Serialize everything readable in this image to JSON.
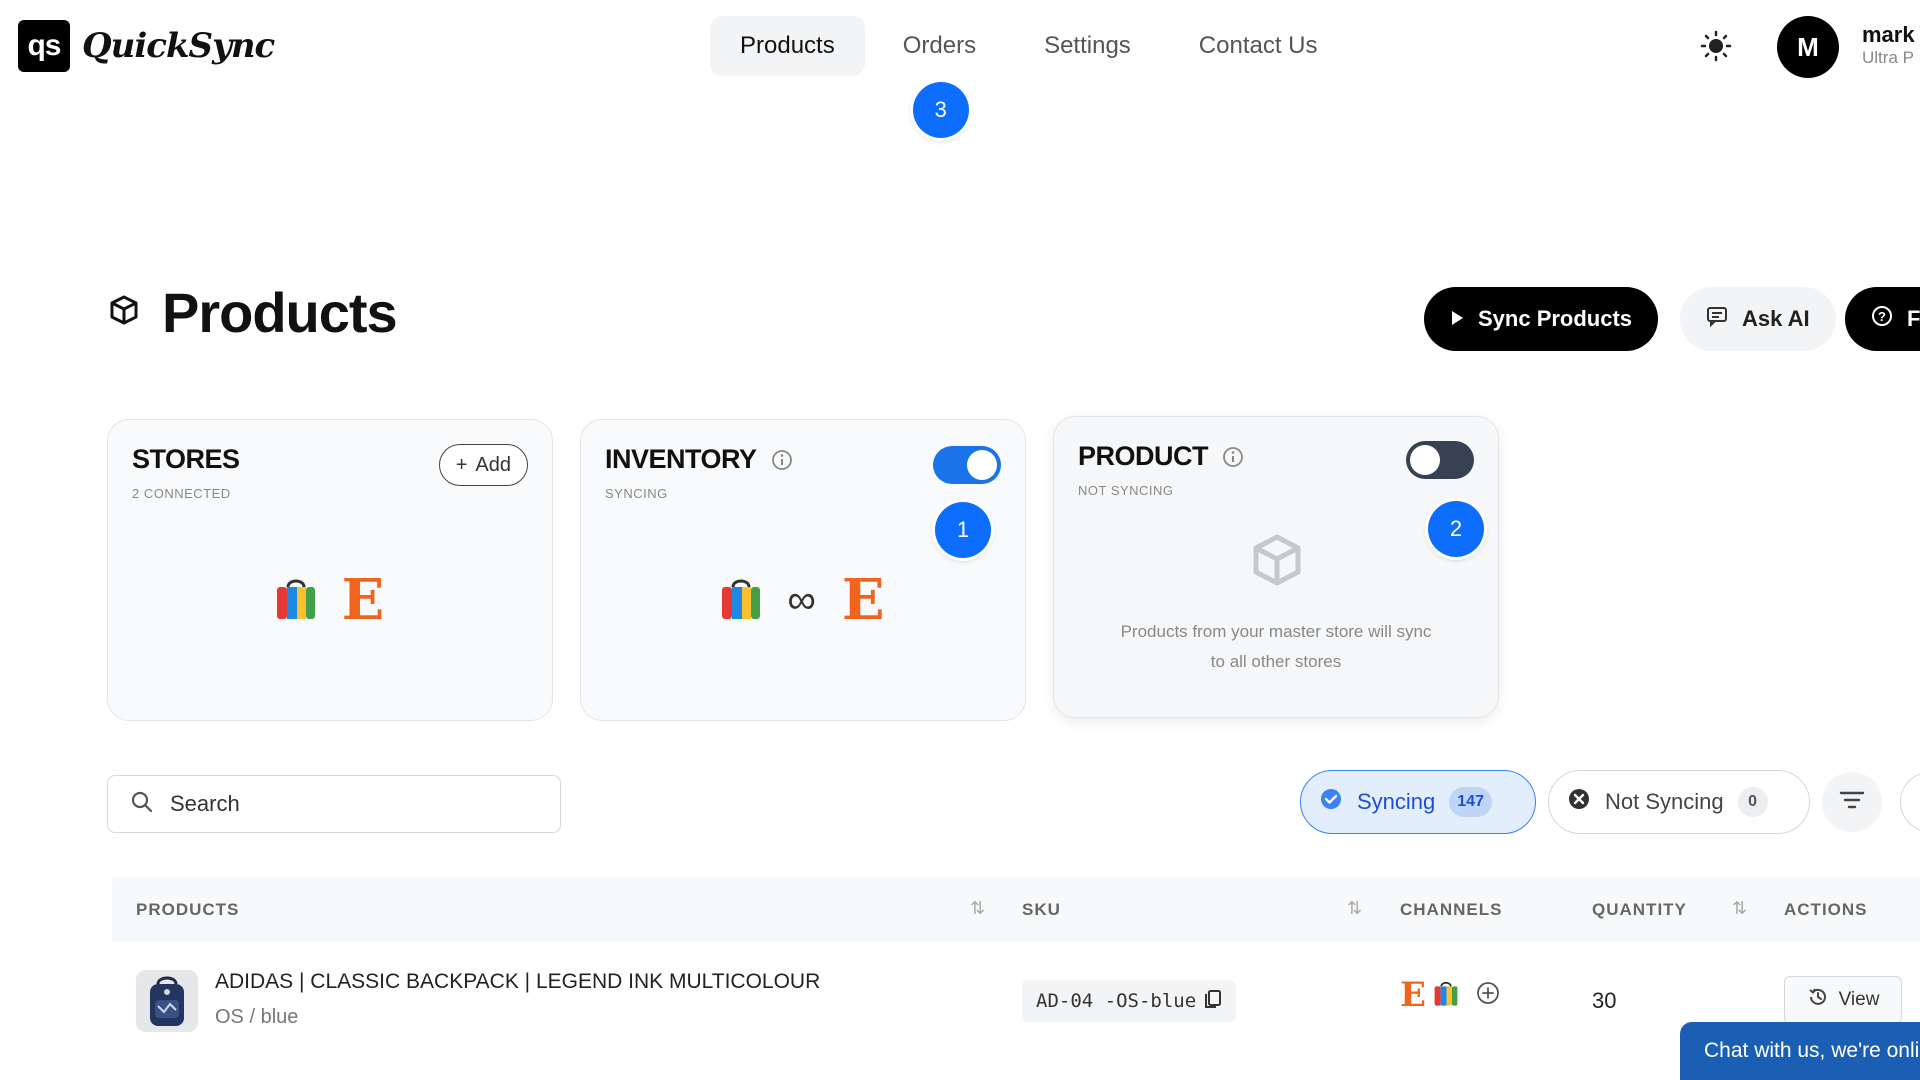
{
  "app": {
    "logo_mark": "qs",
    "logo_text": "QuickSync"
  },
  "nav": {
    "items": [
      {
        "label": "Products",
        "active": true
      },
      {
        "label": "Orders",
        "badge": "3"
      },
      {
        "label": "Settings"
      },
      {
        "label": "Contact Us"
      }
    ]
  },
  "user": {
    "initial": "M",
    "name": "mark",
    "plan": "Ultra P"
  },
  "page": {
    "title": "Products"
  },
  "actions": {
    "sync_label": "Sync Products",
    "ask_ai_label": "Ask AI",
    "faq_label": "FA"
  },
  "cards": {
    "stores": {
      "title": "STORES",
      "subtitle": "2 CONNECTED",
      "add_label": "Add"
    },
    "inventory": {
      "title": "INVENTORY",
      "subtitle": "SYNCING",
      "toggle": "on",
      "badge": "1",
      "link_symbol": "∞"
    },
    "product": {
      "title": "PRODUCT",
      "subtitle": "NOT SYNCING",
      "toggle": "off",
      "badge": "2",
      "description": "Products from your master store will sync to all other stores"
    }
  },
  "filters": {
    "search_placeholder": "Search",
    "syncing": {
      "label": "Syncing",
      "count": "147"
    },
    "not_syncing": {
      "label": "Not Syncing",
      "count": "0"
    }
  },
  "table": {
    "headers": {
      "products": "PRODUCTS",
      "sku": "SKU",
      "channels": "CHANNELS",
      "quantity": "QUANTITY",
      "actions": "ACTIONS"
    },
    "rows": [
      {
        "name": "ADIDAS | CLASSIC BACKPACK | LEGEND INK MULTICOLOUR",
        "variant": "OS / blue",
        "sku": "AD-04 -OS-blue",
        "channel_etsy": "E",
        "quantity": "30",
        "action": "View"
      }
    ]
  },
  "chat": {
    "label": "Chat with us, we're online!"
  },
  "colors": {
    "accent": "#0d6efd",
    "etsy": "#f1641e",
    "toggle_on": "#1a73e8",
    "toggle_off": "#374151"
  }
}
